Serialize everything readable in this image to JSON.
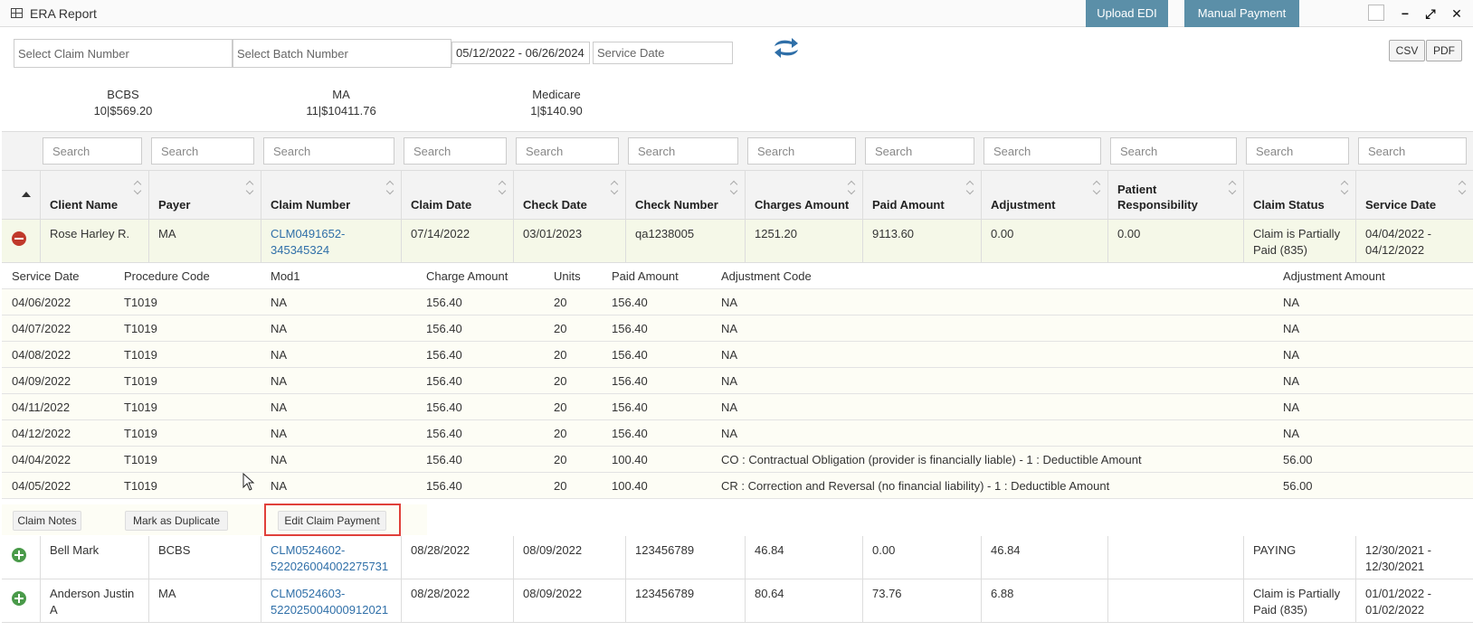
{
  "window": {
    "title": "ERA Report",
    "upload_edi_label": "Upload EDI",
    "manual_payment_label": "Manual Payment",
    "minimize_glyph": "−",
    "maximize_glyph": "⤢",
    "close_glyph": "✕"
  },
  "filters": {
    "claim_number_placeholder": "Select Claim Number",
    "batch_number_placeholder": "Select Batch Number",
    "date_range_value": "05/12/2022 - 06/26/2024",
    "service_date_placeholder": "Service Date",
    "csv_label": "CSV",
    "pdf_label": "PDF"
  },
  "summary": [
    {
      "payer": "BCBS",
      "totals": "10|$569.20"
    },
    {
      "payer": "MA",
      "totals": "11|$10411.76"
    },
    {
      "payer": "Medicare",
      "totals": "1|$140.90"
    }
  ],
  "search_placeholder": "Search",
  "columns": [
    {
      "label": "Client Name"
    },
    {
      "label": "Payer"
    },
    {
      "label": "Claim Number"
    },
    {
      "label": "Claim Date"
    },
    {
      "label": "Check Date"
    },
    {
      "label": "Check Number"
    },
    {
      "label": "Charges Amount"
    },
    {
      "label": "Paid Amount"
    },
    {
      "label": "Adjustment"
    },
    {
      "label": "Patient Responsibility"
    },
    {
      "label": "Claim Status"
    },
    {
      "label": "Service Date"
    }
  ],
  "rows": [
    {
      "expanded": true,
      "cells": [
        "Rose Harley R.",
        "MA",
        "CLM0491652-345345324",
        "07/14/2022",
        "03/01/2023",
        "qa1238005",
        "1251.20",
        "9113.60",
        "0.00",
        "0.00",
        "Claim is Partially Paid (835)",
        "04/04/2022 - 04/12/2022"
      ]
    },
    {
      "expanded": false,
      "cells": [
        "Bell Mark",
        "BCBS",
        "CLM0524602-522026004002275731",
        "08/28/2022",
        "08/09/2022",
        "123456789",
        "46.84",
        "0.00",
        "46.84",
        "",
        "PAYING",
        "12/30/2021 - 12/30/2021"
      ]
    },
    {
      "expanded": false,
      "cells": [
        "Anderson Justin A",
        "MA",
        "CLM0524603-522025004000912021",
        "08/28/2022",
        "08/09/2022",
        "123456789",
        "80.64",
        "73.76",
        "6.88",
        "",
        "Claim is Partially Paid (835)",
        "01/01/2022 - 01/02/2022"
      ]
    }
  ],
  "detail": {
    "headers": [
      "Service Date",
      "Procedure Code",
      "Mod1",
      "Charge Amount",
      "Units",
      "Paid Amount",
      "Adjustment Code",
      "Adjustment Amount"
    ],
    "lines": [
      [
        "04/06/2022",
        "T1019",
        "NA",
        "156.40",
        "20",
        "156.40",
        "NA",
        "NA"
      ],
      [
        "04/07/2022",
        "T1019",
        "NA",
        "156.40",
        "20",
        "156.40",
        "NA",
        "NA"
      ],
      [
        "04/08/2022",
        "T1019",
        "NA",
        "156.40",
        "20",
        "156.40",
        "NA",
        "NA"
      ],
      [
        "04/09/2022",
        "T1019",
        "NA",
        "156.40",
        "20",
        "156.40",
        "NA",
        "NA"
      ],
      [
        "04/11/2022",
        "T1019",
        "NA",
        "156.40",
        "20",
        "156.40",
        "NA",
        "NA"
      ],
      [
        "04/12/2022",
        "T1019",
        "NA",
        "156.40",
        "20",
        "156.40",
        "NA",
        "NA"
      ],
      [
        "04/04/2022",
        "T1019",
        "NA",
        "156.40",
        "20",
        "100.40",
        "CO : Contractual Obligation (provider is financially liable) - 1 : Deductible Amount",
        "56.00"
      ],
      [
        "04/05/2022",
        "T1019",
        "NA",
        "156.40",
        "20",
        "100.40",
        "CR : Correction and Reversal (no financial liability) - 1 : Deductible Amount",
        "56.00"
      ]
    ],
    "actions": {
      "claim_notes": "Claim Notes",
      "mark_duplicate": "Mark as Duplicate",
      "edit_claim_payment": "Edit Claim Payment"
    }
  },
  "colors": {
    "accent_button": "#5b8fa8",
    "link": "#2f6fa8",
    "collapse_icon": "#c0392b",
    "expand_icon": "#4a9a4a",
    "highlight": "#e0403a"
  }
}
